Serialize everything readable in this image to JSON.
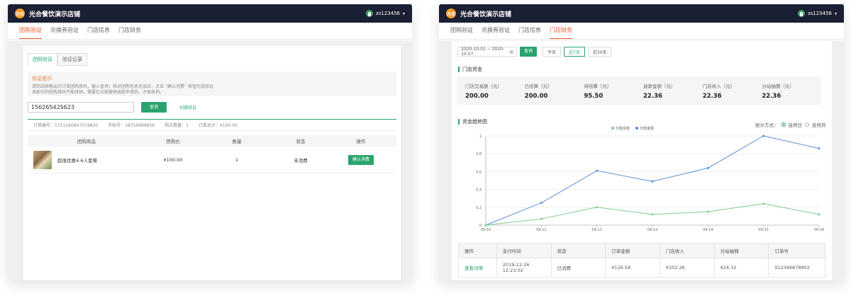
{
  "left": {
    "store_name": "光合餐饮演示店铺",
    "logo_text": "光合",
    "username": "zs123456",
    "nav": [
      "团购验证",
      "兑换券验证",
      "门店信息",
      "门店财务"
    ],
    "tabs": [
      "团购验证",
      "验证记录"
    ],
    "tip_title": "验证提示:",
    "tip_lines": [
      "请到店顾客出示订单团购券码，输入查询；核对团购信息无误后，点击 “确认消费” 按钮完成验证",
      "退款中的团购券码不能核销，需要在买家撤销退款申请后，才能核销。"
    ],
    "code_value": "156265425623",
    "query_label": "查询",
    "scan_label": "扫描验证",
    "order_no": "订单编号：1711160847074820",
    "phone": "手机号：18756989856",
    "qty": "购买数量：1",
    "total": "订单总计：¥100.00",
    "table_headers": [
      "团购商品",
      "团购价",
      "数量",
      "状态",
      "操作"
    ],
    "row": {
      "goods": "超值优惠4-6人套餐",
      "price": "¥100.00",
      "qty": "1",
      "status": "未消费",
      "action": "确认消费"
    }
  },
  "right": {
    "store_name": "光合餐饮演示店铺",
    "logo_text": "光合",
    "username": "zs123456",
    "nav": [
      "团购验证",
      "兑换券验证",
      "门店信息",
      "门店财务"
    ],
    "date_range": "2020-10-01 ~ 2020-10-07",
    "query_label": "查询",
    "quick_ranges": [
      "今天",
      "近7天",
      "近30天"
    ],
    "funds_title": "门店资金",
    "stats": [
      {
        "label": "门店交易额（元）",
        "value": "200.00"
      },
      {
        "label": "已结算（元）",
        "value": "200.00"
      },
      {
        "label": "待结算（元）",
        "value": "95.50"
      },
      {
        "label": "退款金额（元）",
        "value": "22.36"
      },
      {
        "label": "门店收入（元）",
        "value": "22.36"
      },
      {
        "label": "分站抽佣（元）",
        "value": "22.36"
      }
    ],
    "trend_title": "资金趋势图",
    "stat_mode_label": "统计方式：",
    "stat_mode_options": [
      "自然日",
      "自然月"
    ],
    "table_headers": [
      "操作",
      "支付时间",
      "状态",
      "订单金额",
      "门店收入",
      "分站抽佣",
      "订单号"
    ],
    "table_row": [
      "查看详情",
      "2019-12-26 12:23:02",
      "已消费",
      "¥126.58",
      "¥102.26",
      "¥24.32",
      "012346878902"
    ]
  },
  "chart_data": {
    "type": "line",
    "x": [
      "09-10",
      "09-11",
      "09-12",
      "09-13",
      "09-14",
      "09-15",
      "09-16"
    ],
    "ylim": [
      0,
      1
    ],
    "y_ticks": [
      "0",
      "0.2",
      "0.4",
      "0.6",
      "0.8",
      "1"
    ],
    "series": [
      {
        "name": "付款金额",
        "color": "#5b8fd9",
        "values": [
          0,
          0.25,
          0.61,
          0.49,
          0.64,
          1.0,
          0.86
        ]
      },
      {
        "name": "付款票数",
        "color": "#7ccc8e",
        "values": [
          0,
          0.07,
          0.2,
          0.12,
          0.15,
          0.24,
          0.12
        ]
      }
    ],
    "legend_position": "top-center",
    "grid": true
  },
  "colors": {
    "accent": "#2aa46e",
    "nav_active": "#e55b30",
    "topbar": "#1b1f33"
  }
}
